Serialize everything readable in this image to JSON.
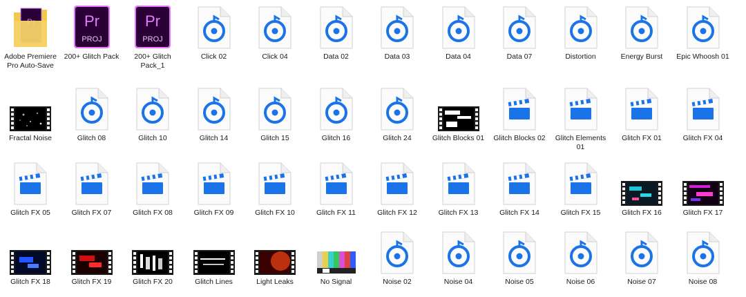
{
  "files": [
    {
      "label": "Adobe Premiere Pro Auto-Save",
      "type": "folder"
    },
    {
      "label": "200+ Glitch Pack",
      "type": "prproj",
      "badge": "Pr",
      "sub": "PROJ"
    },
    {
      "label": "200+ Glitch Pack_1",
      "type": "prproj",
      "badge": "Pr",
      "sub": "PROJ"
    },
    {
      "label": "Click 02",
      "type": "audio"
    },
    {
      "label": "Click 04",
      "type": "audio"
    },
    {
      "label": "Data 02",
      "type": "audio"
    },
    {
      "label": "Data 03",
      "type": "audio"
    },
    {
      "label": "Data 04",
      "type": "audio"
    },
    {
      "label": "Data 07",
      "type": "audio"
    },
    {
      "label": "Distortion",
      "type": "audio"
    },
    {
      "label": "Energy Burst",
      "type": "audio"
    },
    {
      "label": "Epic Whoosh 01",
      "type": "audio"
    },
    {
      "label": "Fractal Noise",
      "type": "film",
      "theme": "fractal"
    },
    {
      "label": "Glitch 08",
      "type": "audio"
    },
    {
      "label": "Glitch 10",
      "type": "audio"
    },
    {
      "label": "Glitch 14",
      "type": "audio"
    },
    {
      "label": "Glitch 15",
      "type": "audio"
    },
    {
      "label": "Glitch 16",
      "type": "audio"
    },
    {
      "label": "Glitch 24",
      "type": "audio"
    },
    {
      "label": "Glitch Blocks 01",
      "type": "film",
      "theme": "blocks"
    },
    {
      "label": "Glitch Blocks 02",
      "type": "video"
    },
    {
      "label": "Glitch Elements 01",
      "type": "video"
    },
    {
      "label": "Glitch FX 01",
      "type": "video"
    },
    {
      "label": "Glitch FX 04",
      "type": "video"
    },
    {
      "label": "Glitch FX 05",
      "type": "video"
    },
    {
      "label": "Glitch FX 07",
      "type": "video"
    },
    {
      "label": "Glitch FX 08",
      "type": "video"
    },
    {
      "label": "Glitch FX 09",
      "type": "video"
    },
    {
      "label": "Glitch FX 10",
      "type": "video"
    },
    {
      "label": "Glitch FX 11",
      "type": "video"
    },
    {
      "label": "Glitch FX 12",
      "type": "video"
    },
    {
      "label": "Glitch FX 13",
      "type": "video"
    },
    {
      "label": "Glitch FX 14",
      "type": "video"
    },
    {
      "label": "Glitch FX 15",
      "type": "video"
    },
    {
      "label": "Glitch FX 16",
      "type": "film",
      "theme": "cyan"
    },
    {
      "label": "Glitch FX 17",
      "type": "film",
      "theme": "magenta"
    },
    {
      "label": "Glitch FX 18",
      "type": "film",
      "theme": "blue"
    },
    {
      "label": "Glitch FX 19",
      "type": "film",
      "theme": "red"
    },
    {
      "label": "Glitch FX 20",
      "type": "film",
      "theme": "white"
    },
    {
      "label": "Glitch Lines",
      "type": "film",
      "theme": "lines"
    },
    {
      "label": "Light Leaks",
      "type": "film",
      "theme": "leak"
    },
    {
      "label": "No Signal",
      "type": "bars"
    },
    {
      "label": "Noise 02",
      "type": "audio"
    },
    {
      "label": "Noise 04",
      "type": "audio"
    },
    {
      "label": "Noise 05",
      "type": "audio"
    },
    {
      "label": "Noise 06",
      "type": "audio"
    },
    {
      "label": "Noise 07",
      "type": "audio"
    },
    {
      "label": "Noise 08",
      "type": "audio"
    }
  ],
  "colors": {
    "accent_blue": "#1a73e8",
    "premiere_purple": "#2a0134",
    "premiere_text": "#e77cff",
    "folder_yellow": "#f4c84a"
  }
}
